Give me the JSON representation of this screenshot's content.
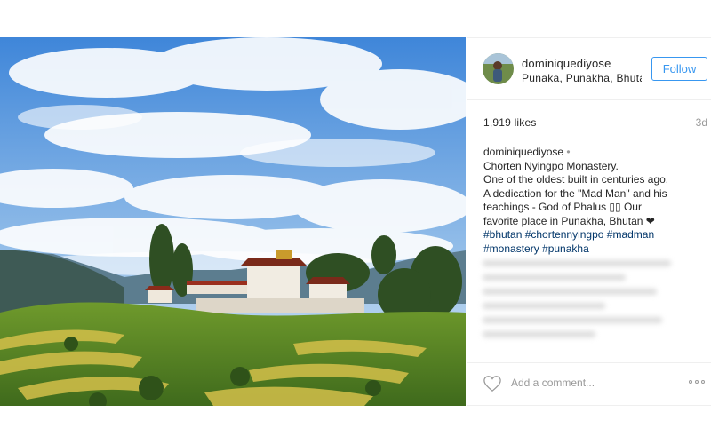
{
  "post": {
    "photo_alt": "Chorten Nyingpo Monastery",
    "header": {
      "username": "dominiquediyose",
      "location": "Punaka, Punakha, Bhutan",
      "follow_label": "Follow"
    },
    "likes_text": "1,919 likes",
    "time_ago": "3d",
    "caption": {
      "username": "dominiquediyose",
      "separator": "•",
      "lines": [
        "Chorten Nyingpo Monastery.",
        "One of the oldest built in centuries ago.",
        "A dedication for the \"Mad Man\" and his",
        "teachings - God of Phalus ▯▯ Our",
        "favorite place in Punakha, Bhutan ❤"
      ],
      "hashtags": [
        "#bhutan #chortennyingpo #madman",
        "#monastery #punakha"
      ]
    },
    "comment": {
      "placeholder": "Add a comment..."
    },
    "colors": {
      "accent": "#3897f0",
      "hashtag": "#003569",
      "muted": "#999999"
    },
    "icons": {
      "like": "heart-icon",
      "more": "more-options-icon"
    }
  }
}
